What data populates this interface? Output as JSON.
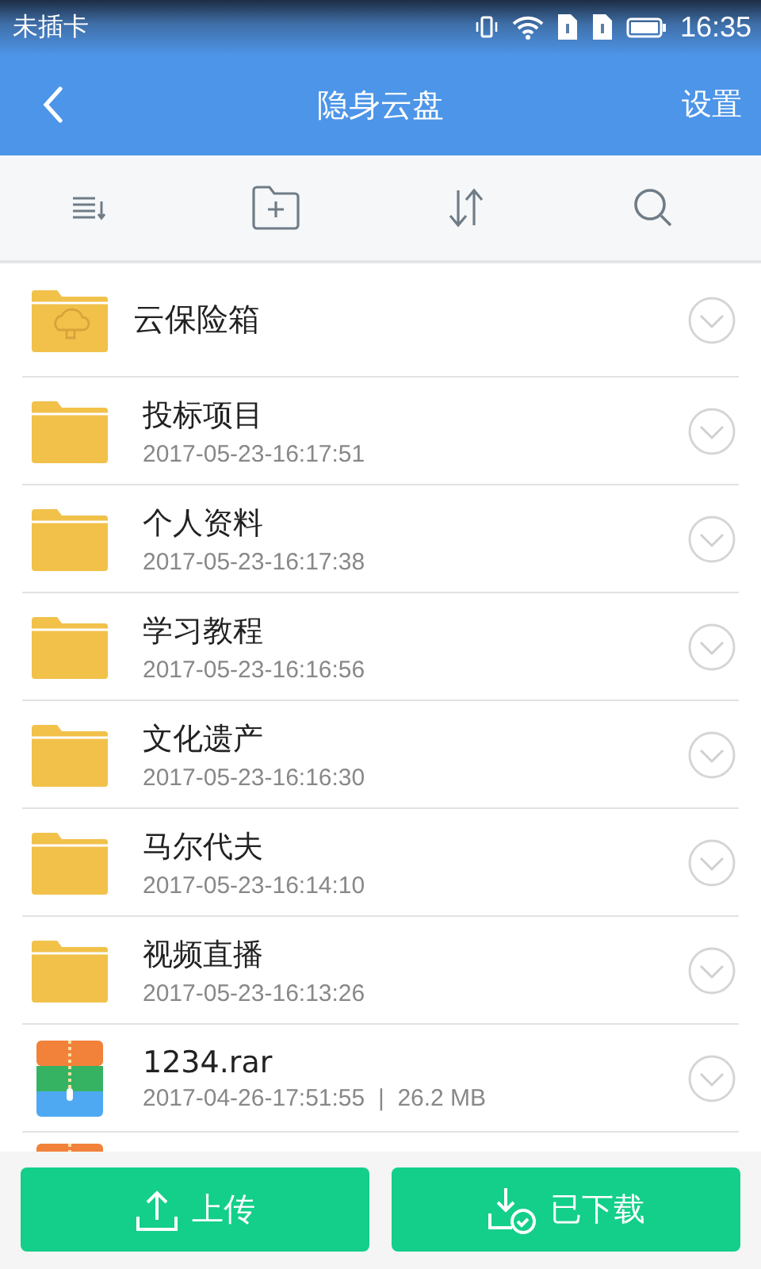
{
  "status_bar": {
    "carrier": "未插卡",
    "time": "16:35"
  },
  "header": {
    "title": "隐身云盘",
    "action": "设置"
  },
  "files": [
    {
      "kind": "vault",
      "name": "云保险箱"
    },
    {
      "kind": "folder",
      "name": "投标项目",
      "date": "2017-05-23-16:17:51"
    },
    {
      "kind": "folder",
      "name": "个人资料",
      "date": "2017-05-23-16:17:38"
    },
    {
      "kind": "folder",
      "name": "学习教程",
      "date": "2017-05-23-16:16:56"
    },
    {
      "kind": "folder",
      "name": "文化遗产",
      "date": "2017-05-23-16:16:30"
    },
    {
      "kind": "folder",
      "name": "马尔代夫",
      "date": "2017-05-23-16:14:10"
    },
    {
      "kind": "folder",
      "name": "视频直播",
      "date": "2017-05-23-16:13:26"
    },
    {
      "kind": "archive",
      "name": "1234.rar",
      "date": "2017-04-26-17:51:55",
      "separator": "|",
      "size": "26.2 MB"
    },
    {
      "kind": "archive"
    }
  ],
  "buttons": [
    {
      "kind": "upload",
      "label": "上传"
    },
    {
      "kind": "downloaded",
      "label": "已下载"
    }
  ]
}
